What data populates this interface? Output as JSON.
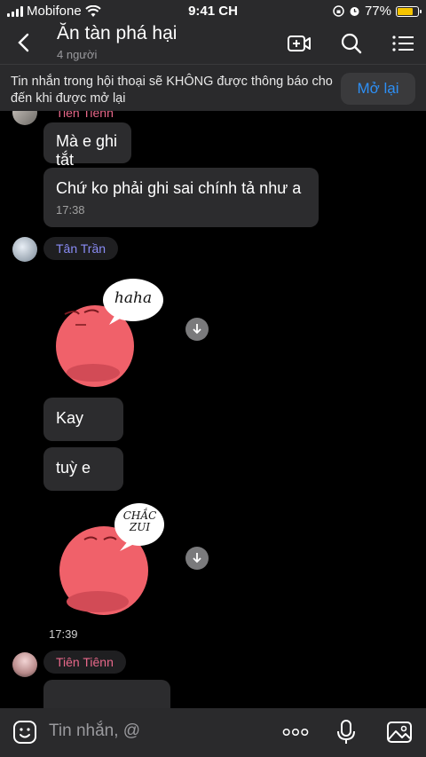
{
  "status_bar": {
    "carrier": "Mobifone",
    "time": "9:41 CH",
    "battery": "77%",
    "battery_level": 0.77
  },
  "header": {
    "title": "Ăn tàn phá hại",
    "member_count": "4 người",
    "icons": [
      "back-icon",
      "video-add-icon",
      "search-icon",
      "menu-icon"
    ]
  },
  "notice": {
    "text": "Tin nhắn trong hội thoại sẽ KHÔNG được thông báo cho đến khi được mở lại",
    "button_label": "Mở lại"
  },
  "messages": [
    {
      "sender": "Tiên Tiênn",
      "text": "Mà e ghi tắt"
    },
    {
      "sender": "Tiên Tiênn",
      "text": "Chứ ko phải ghi sai chính tả như a",
      "time": "17:38"
    },
    {
      "sender": "Tân Trần"
    },
    {
      "sender": "Tân Trần",
      "sticker": "blob-haha",
      "sticker_text": "haha"
    },
    {
      "sender": "Tân Trần",
      "text": "Kay"
    },
    {
      "sender": "Tân Trần",
      "text": "tuỳ e"
    },
    {
      "sender": "Tân Trần",
      "sticker": "blob-chac-zui",
      "sticker_text": "CHẮC ZUI",
      "time": "17:39"
    },
    {
      "sender": "Tiên Tiênn"
    }
  ],
  "senders": {
    "first_partial": "Tiên Tiênn",
    "second": "Tân Trần",
    "third": "Tiên Tiênn"
  },
  "composer": {
    "placeholder": "Tin nhắn, @",
    "icons": [
      "emoji-icon",
      "more-icon",
      "microphone-icon",
      "image-icon"
    ]
  },
  "colors": {
    "background": "#000000",
    "bar": "#2a2a2c",
    "bubble": "#2c2c2e",
    "accent_blue": "#2d8ff5",
    "name_pink": "#e8688a",
    "name_blue": "#8a8cf5",
    "sticker_red": "#f0616a"
  }
}
